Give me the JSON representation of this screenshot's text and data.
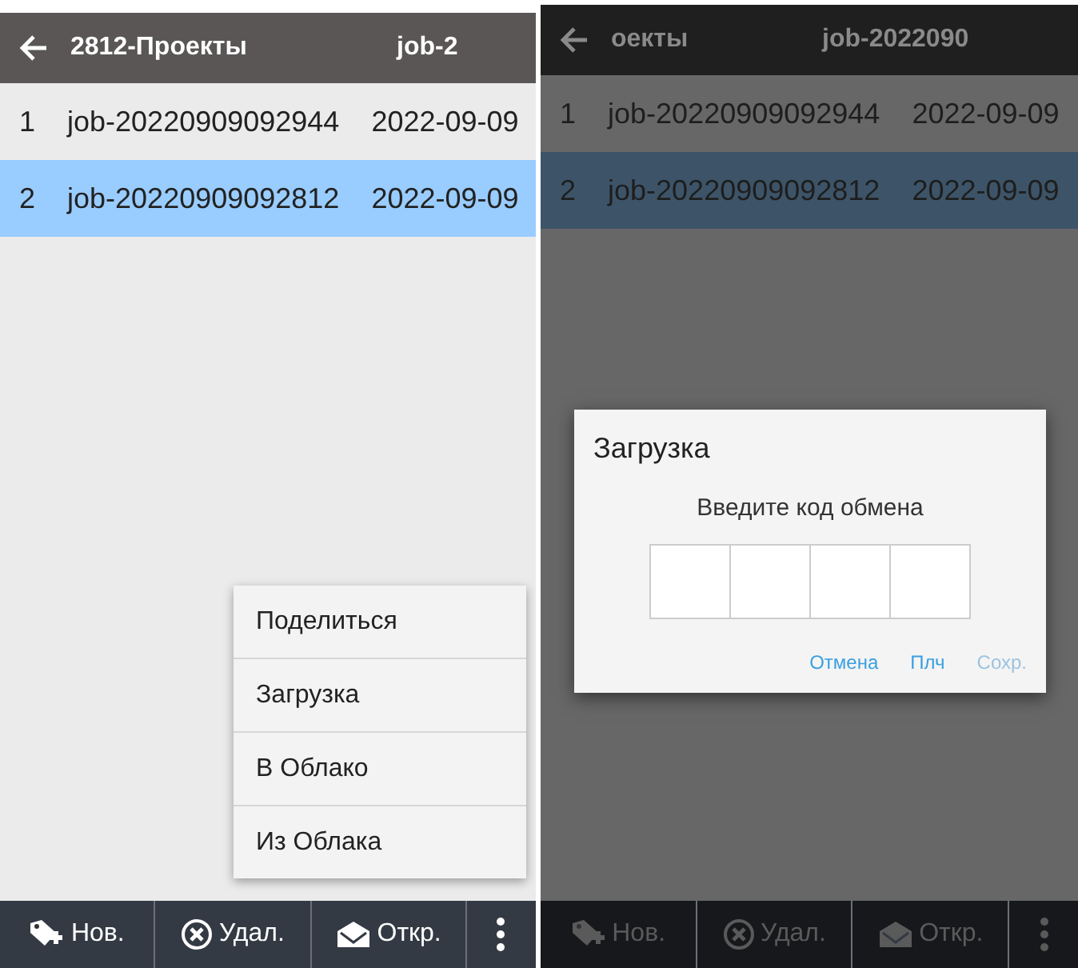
{
  "screens": [
    {
      "dimmed": false,
      "title": {
        "left": "2812-Проекты",
        "right": "job-2"
      },
      "rows": [
        {
          "number": "1",
          "name": "job-20220909092944",
          "date": "2022-09-09",
          "selected": false
        },
        {
          "number": "2",
          "name": "job-20220909092812",
          "date": "2022-09-09",
          "selected": true
        }
      ],
      "menu": [
        "Поделиться",
        "Загрузка",
        "В Облако",
        "Из Облака"
      ],
      "toolbar": [
        "Нов.",
        "Удал.",
        "Откр."
      ]
    },
    {
      "dimmed": true,
      "title": {
        "left": "оекты",
        "right": "job-2022090"
      },
      "rows": [
        {
          "number": "1",
          "name": "job-20220909092944",
          "date": "2022-09-09",
          "selected": false
        },
        {
          "number": "2",
          "name": "job-20220909092812",
          "date": "2022-09-09",
          "selected": true
        }
      ],
      "dialog": {
        "title": "Загрузка",
        "message": "Введите код обмена",
        "buttons": [
          {
            "label": "Отмена",
            "disabled": false
          },
          {
            "label": "Плч",
            "disabled": false
          },
          {
            "label": "Сохр.",
            "disabled": true
          }
        ]
      },
      "toolbar": [
        "Нов.",
        "Удал.",
        "Откр."
      ]
    }
  ]
}
